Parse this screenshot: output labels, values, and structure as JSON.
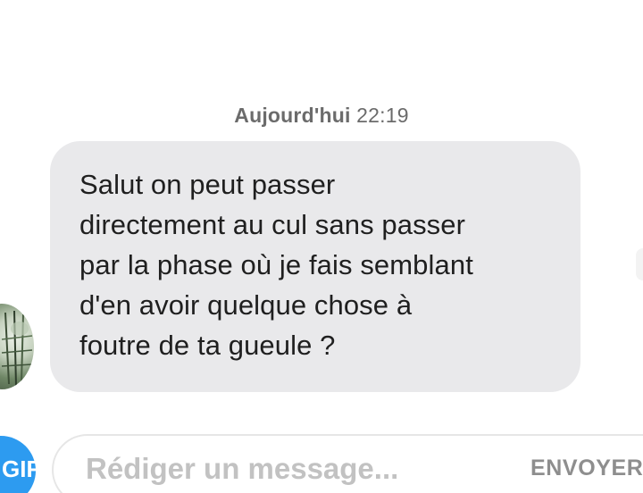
{
  "conversation": {
    "timestamp": {
      "day": "Aujourd'hui",
      "time": "22:19"
    },
    "messages": [
      {
        "direction": "incoming",
        "text": "Salut on peut passer\ndirectement au cul sans passer\npar la phase où je fais semblant\nd'en avoir quelque chose à\nfoutre de ta gueule ?"
      }
    ]
  },
  "composer": {
    "gif_label": "GIF",
    "placeholder": "Rédiger un message...",
    "send_label": "ENVOYER"
  },
  "colors": {
    "bubble_background": "#e9e9eb",
    "gif_button": "#2d9bf0",
    "timestamp_text": "#6b6b6b",
    "placeholder_text": "#c2c2c2"
  }
}
